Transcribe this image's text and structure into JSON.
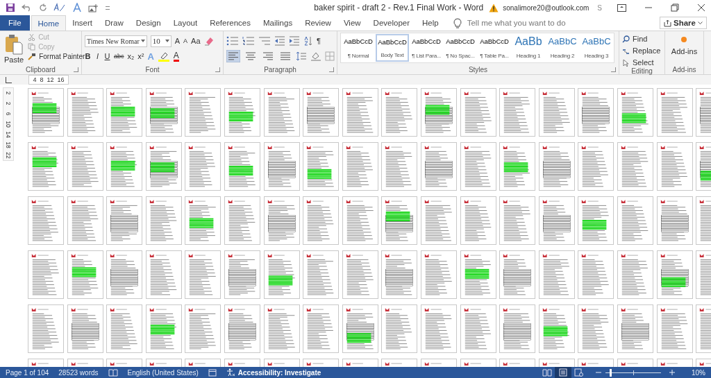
{
  "window": {
    "title": "baker spirit - draft 2 - Rev.1 Final Work  -  Word",
    "account": "sonalimore20@outlook.com",
    "account_initial": "S"
  },
  "tabs": [
    {
      "label": "File",
      "kind": "file",
      "selected": false
    },
    {
      "label": "Home",
      "kind": "tab",
      "selected": true
    },
    {
      "label": "Insert",
      "kind": "tab",
      "selected": false
    },
    {
      "label": "Draw",
      "kind": "tab",
      "selected": false
    },
    {
      "label": "Design",
      "kind": "tab",
      "selected": false
    },
    {
      "label": "Layout",
      "kind": "tab",
      "selected": false
    },
    {
      "label": "References",
      "kind": "tab",
      "selected": false
    },
    {
      "label": "Mailings",
      "kind": "tab",
      "selected": false
    },
    {
      "label": "Review",
      "kind": "tab",
      "selected": false
    },
    {
      "label": "View",
      "kind": "tab",
      "selected": false
    },
    {
      "label": "Developer",
      "kind": "tab",
      "selected": false
    },
    {
      "label": "Help",
      "kind": "tab",
      "selected": false
    }
  ],
  "tell_me": {
    "placeholder": "Tell me what you want to do"
  },
  "share": "Share",
  "clipboard": {
    "group": "Clipboard",
    "paste": "Paste",
    "items": [
      {
        "label": "Cut",
        "disabled": true
      },
      {
        "label": "Copy",
        "disabled": true
      },
      {
        "label": "Format Painter",
        "disabled": false
      }
    ]
  },
  "font": {
    "group": "Font",
    "family": "Times New Romar",
    "size": "10",
    "grow": "A",
    "shrink": "A",
    "case": "Aa",
    "format": [
      "B",
      "I",
      "U",
      "abc",
      "x₂",
      "x²"
    ],
    "effects": "A",
    "font_color_letter": "A"
  },
  "paragraph": {
    "group": "Paragraph",
    "pilcrow": "¶",
    "align": [
      {
        "kind": "left",
        "selected": true
      },
      {
        "kind": "center",
        "selected": false
      },
      {
        "kind": "right",
        "selected": false
      },
      {
        "kind": "justify",
        "selected": false
      }
    ]
  },
  "styles": {
    "group": "Styles",
    "items": [
      {
        "preview": "AaBbCcD",
        "name": "¶ Normal",
        "kind": "body",
        "selected": false
      },
      {
        "preview": "AaBbCcD",
        "name": "Body Text",
        "kind": "body",
        "selected": true
      },
      {
        "preview": "AaBbCcD",
        "name": "¶ List Para...",
        "kind": "body",
        "selected": false
      },
      {
        "preview": "AaBbCcD",
        "name": "¶ No Spac...",
        "kind": "body",
        "selected": false
      },
      {
        "preview": "AaBbCcD",
        "name": "¶ Table Pa...",
        "kind": "body",
        "selected": false
      },
      {
        "preview": "AaBb",
        "name": "Heading 1",
        "kind": "heading1",
        "selected": false
      },
      {
        "preview": "AaBbC",
        "name": "Heading 2",
        "kind": "heading2",
        "selected": false
      },
      {
        "preview": "AaBbC",
        "name": "Heading 3",
        "kind": "heading2",
        "selected": false
      }
    ]
  },
  "editing": {
    "group": "Editing",
    "items": [
      {
        "label": "Find",
        "kind": "find"
      },
      {
        "label": "Replace",
        "kind": "replace"
      },
      {
        "label": "Select",
        "kind": "select"
      }
    ]
  },
  "addins": {
    "group": "Add-ins",
    "label": "Add-ins"
  },
  "ruler": {
    "horizontal": [
      "4",
      "8",
      "12",
      "16"
    ],
    "vertical": [
      "2",
      "2",
      "6",
      "10",
      "14",
      "18",
      "22"
    ]
  },
  "status_bar": {
    "page": "Page 1 of 104",
    "words": "28523 words",
    "language": "English (United States)",
    "accessibility": "Accessibility: Investigate",
    "zoom": "10%",
    "views": [
      {
        "kind": "read",
        "selected": false
      },
      {
        "kind": "print",
        "selected": true
      },
      {
        "kind": "web",
        "selected": false
      }
    ],
    "zoom_slider": {
      "level": 0.08
    }
  }
}
